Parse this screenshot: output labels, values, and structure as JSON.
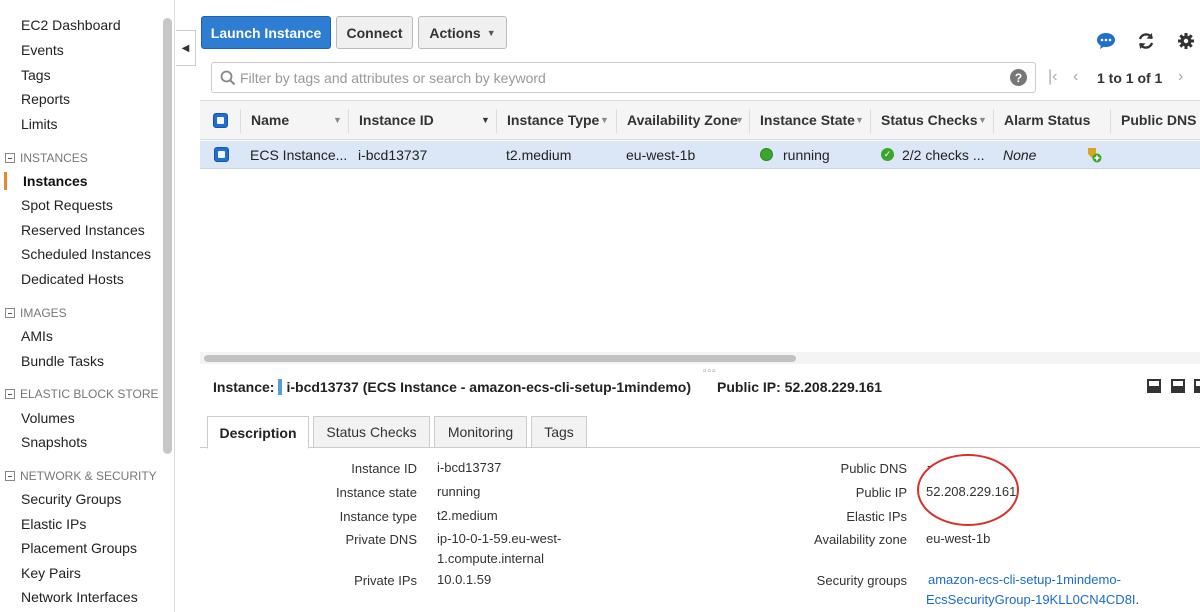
{
  "sidebar": {
    "items_top": [
      "EC2 Dashboard",
      "Events",
      "Tags",
      "Reports",
      "Limits"
    ],
    "sections": [
      {
        "title": "INSTANCES",
        "items": [
          "Instances",
          "Spot Requests",
          "Reserved Instances",
          "Scheduled Instances",
          "Dedicated Hosts"
        ]
      },
      {
        "title": "IMAGES",
        "items": [
          "AMIs",
          "Bundle Tasks"
        ]
      },
      {
        "title": "ELASTIC BLOCK STORE",
        "items": [
          "Volumes",
          "Snapshots"
        ]
      },
      {
        "title": "NETWORK & SECURITY",
        "items": [
          "Security Groups",
          "Elastic IPs",
          "Placement Groups",
          "Key Pairs",
          "Network Interfaces"
        ]
      }
    ],
    "active_item": "Instances"
  },
  "toolbar": {
    "launch_label": "Launch Instance",
    "connect_label": "Connect",
    "actions_label": "Actions"
  },
  "search": {
    "placeholder": "Filter by tags and attributes or search by keyword",
    "value": "",
    "help": "?"
  },
  "pager": {
    "text": "1 to 1 of 1"
  },
  "table": {
    "columns": [
      "Name",
      "Instance ID",
      "Instance Type",
      "Availability Zone",
      "Instance State",
      "Status Checks",
      "Alarm Status",
      "Public DNS"
    ],
    "row": {
      "name": "ECS Instance...",
      "instance_id": "i-bcd13737",
      "instance_type": "t2.medium",
      "availability_zone": "eu-west-1b",
      "instance_state": "running",
      "status_checks": "2/2 checks ...",
      "alarm_status": "None",
      "public_dns": ""
    }
  },
  "details": {
    "instance_label": "Instance:",
    "instance_value": "i-bcd13737 (ECS Instance - amazon-ecs-cli-setup-1mindemo)",
    "public_ip_header": "Public IP: 52.208.229.161",
    "tabs": [
      "Description",
      "Status Checks",
      "Monitoring",
      "Tags"
    ],
    "active_tab": "Description",
    "left_fields": [
      {
        "label": "Instance ID",
        "value": "i-bcd13737"
      },
      {
        "label": "Instance state",
        "value": "running"
      },
      {
        "label": "Instance type",
        "value": "t2.medium"
      },
      {
        "label": "Private DNS",
        "value_line1": "ip-10-0-1-59.eu-west-",
        "value_line2": "1.compute.internal"
      },
      {
        "label": "Private IPs",
        "value": "10.0.1.59"
      }
    ],
    "right_fields": [
      {
        "label": "Public DNS",
        "value": "-"
      },
      {
        "label": "Public IP",
        "value": "52.208.229.161"
      },
      {
        "label": "Elastic IPs",
        "value": ""
      },
      {
        "label": "Availability zone",
        "value": "eu-west-1b"
      },
      {
        "label": "Security groups",
        "value_line1": "amazon-ecs-cli-setup-1mindemo-",
        "value_line2": "EcsSecurityGroup-19KLL0CN4CD8I",
        "value_suffix": "."
      }
    ]
  },
  "colors": {
    "primary_button": "#2d7dd2",
    "selected_row": "#dbe7f7",
    "running": "#3aa62c",
    "active_nav": "#e8882b",
    "annotation_circle": "#d6322b",
    "link": "#1a6cc8"
  },
  "icons": [
    "chevron-left-icon",
    "chat-icon",
    "refresh-icon",
    "gear-icon",
    "search-icon",
    "help-icon",
    "first-page-icon",
    "prev-page-icon",
    "next-page-icon",
    "last-page-icon",
    "alarm-add-icon",
    "layout-icon"
  ]
}
